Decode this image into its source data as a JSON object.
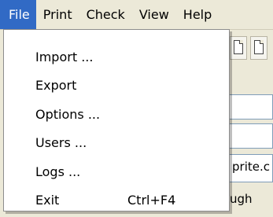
{
  "menubar": {
    "items": [
      {
        "label": "File"
      },
      {
        "label": "Print"
      },
      {
        "label": "Check"
      },
      {
        "label": "View"
      },
      {
        "label": "Help"
      }
    ]
  },
  "file_menu": {
    "items": [
      {
        "label": "Import ..."
      },
      {
        "label": "Export"
      },
      {
        "label": "Options ..."
      },
      {
        "label": "Users ..."
      },
      {
        "label": "Logs ..."
      },
      {
        "label": "Exit",
        "shortcut": "Ctrl+F4"
      }
    ]
  },
  "background": {
    "field_text_1": "prite.c",
    "field_text_2": "ugh"
  },
  "colors": {
    "menu_highlight": "#316ac5",
    "menubar_bg": "#ece9d8"
  }
}
